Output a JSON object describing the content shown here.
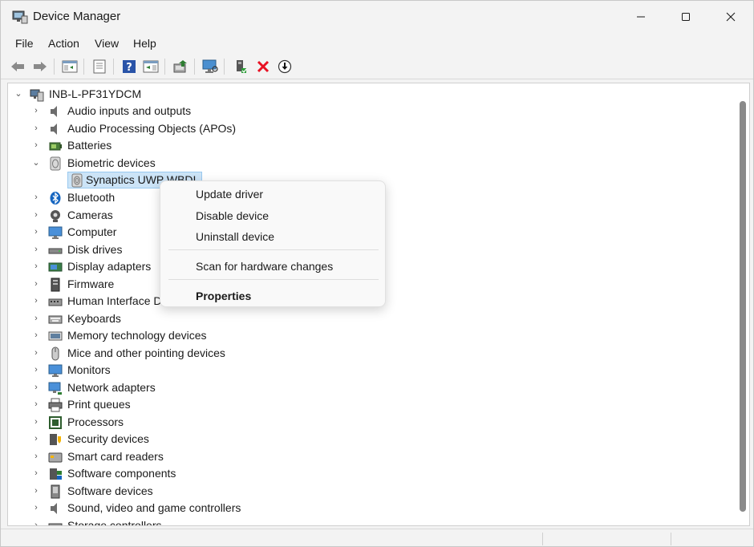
{
  "window": {
    "title": "Device Manager",
    "controls": {
      "minimize": "—",
      "maximize": "☐",
      "close": "✕"
    }
  },
  "menubar": {
    "items": [
      "File",
      "Action",
      "View",
      "Help"
    ]
  },
  "toolbar": {
    "buttons": [
      "back-arrow",
      "forward-arrow",
      "show-hide-tree",
      "properties-sheet",
      "help",
      "action-pane",
      "update-driver",
      "scan-computer",
      "enable-device",
      "uninstall-device",
      "download-driver"
    ]
  },
  "tree": {
    "root": "INB-L-PF31YDCM",
    "categories": [
      {
        "label": "Audio inputs and outputs",
        "expanded": false
      },
      {
        "label": "Audio Processing Objects (APOs)",
        "expanded": false
      },
      {
        "label": "Batteries",
        "expanded": false
      },
      {
        "label": "Biometric devices",
        "expanded": true
      },
      {
        "label": "Bluetooth",
        "expanded": false
      },
      {
        "label": "Cameras",
        "expanded": false
      },
      {
        "label": "Computer",
        "expanded": false
      },
      {
        "label": "Disk drives",
        "expanded": false
      },
      {
        "label": "Display adapters",
        "expanded": false
      },
      {
        "label": "Firmware",
        "expanded": false
      },
      {
        "label": "Human Interface D",
        "expanded": false
      },
      {
        "label": "Keyboards",
        "expanded": false
      },
      {
        "label": "Memory technology devices",
        "expanded": false
      },
      {
        "label": "Mice and other pointing devices",
        "expanded": false
      },
      {
        "label": "Monitors",
        "expanded": false
      },
      {
        "label": "Network adapters",
        "expanded": false
      },
      {
        "label": "Print queues",
        "expanded": false
      },
      {
        "label": "Processors",
        "expanded": false
      },
      {
        "label": "Security devices",
        "expanded": false
      },
      {
        "label": "Smart card readers",
        "expanded": false
      },
      {
        "label": "Software components",
        "expanded": false
      },
      {
        "label": "Software devices",
        "expanded": false
      },
      {
        "label": "Sound, video and game controllers",
        "expanded": false
      },
      {
        "label": "Storage controllers",
        "expanded": false
      }
    ],
    "selected_child": "Synaptics UWP WBDI"
  },
  "context_menu": {
    "items": [
      "Update driver",
      "Disable device",
      "Uninstall device",
      "Scan for hardware changes",
      "Properties"
    ]
  },
  "colors": {
    "selection": "#cce4f7",
    "delete_red": "#e81123",
    "accent_blue": "#0067c0"
  }
}
